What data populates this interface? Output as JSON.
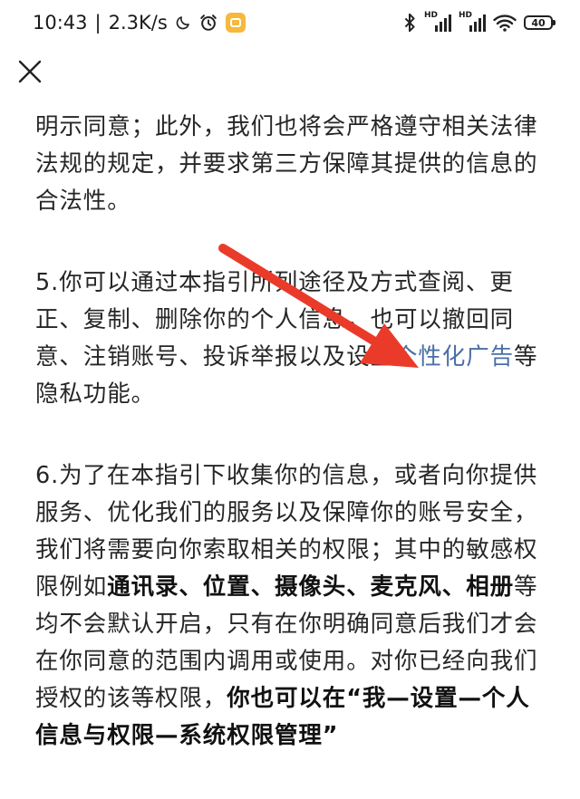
{
  "status_bar": {
    "time": "10:43",
    "separator": "|",
    "network_speed": "2.3K/s",
    "hd_label_1": "HD",
    "hd_label_2": "HD",
    "battery_level": "40"
  },
  "icons": {
    "moon": "moon-icon",
    "alarm": "alarm-clock-icon",
    "app": "notification-app-icon",
    "bluetooth": "bluetooth-icon",
    "signal": "cell-signal-icon",
    "wifi": "wifi-icon",
    "battery": "battery-icon",
    "close": "close-icon",
    "arrow": "red-arrow-annotation"
  },
  "colors": {
    "link": "#4a6fa5",
    "arrow": "#ea3b2a",
    "text": "#262626"
  },
  "article": {
    "p1": {
      "text": "明示同意；此外，我们也将会严格遵守相关法律法规的规定，并要求第三方保障其提供的信息的合法性。"
    },
    "p2": {
      "text_before_link": "5.你可以通过本指引所列途径及方式查阅、更正、复制、删除你的个人信息，也可以撤回同意、注销账号、投诉举报以及设置",
      "link_text": "个性化广告",
      "text_after_link": "等隐私功能。"
    },
    "p3": {
      "t1": "6.为了在本指引下收集你的信息，或者向你提供服务、优化我们的服务以及保障你的账号安全，我们将需要向你索取相关的权限；其中的敏感权限例如",
      "b1": "通讯录、位置、摄像头、麦克风、相册",
      "t2": "等均不会默认开启，只有在你明确同意后我们才会在你同意的范围内调用或使用。对你已经向我们授权的该等权限，",
      "b2": "你也可以在“我—设置—个人信息与权限—系统权限管理”"
    }
  }
}
